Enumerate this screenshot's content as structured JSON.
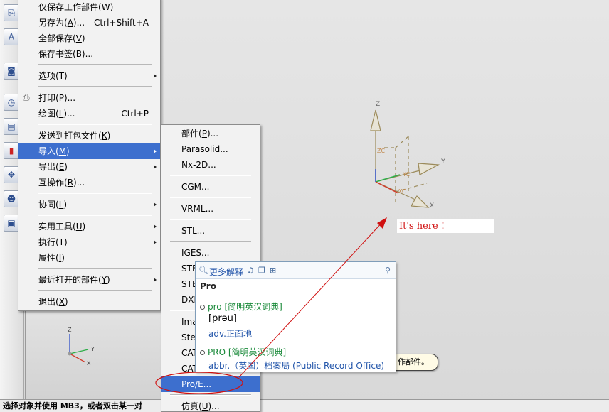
{
  "file_menu": {
    "items": [
      {
        "label": "仅保存工作部件(",
        "key": "W",
        "tail": ")",
        "shortcut": ""
      },
      {
        "label": "另存为(",
        "key": "A",
        "tail": ")...",
        "shortcut": "Ctrl+Shift+A"
      },
      {
        "label": "全部保存(",
        "key": "V",
        "tail": ")",
        "shortcut": ""
      },
      {
        "label": "保存书签(",
        "key": "B",
        "tail": ")...",
        "shortcut": ""
      },
      {
        "label": "选项(",
        "key": "T",
        "tail": ")",
        "shortcut": ""
      },
      {
        "label": "打印(",
        "key": "P",
        "tail": ")...",
        "shortcut": ""
      },
      {
        "label": "绘图(",
        "key": "L",
        "tail": ")...",
        "shortcut": "Ctrl+P"
      },
      {
        "label": "发送到打包文件(",
        "key": "K",
        "tail": ")",
        "shortcut": ""
      },
      {
        "label": "导入(",
        "key": "M",
        "tail": ")",
        "shortcut": ""
      },
      {
        "label": "导出(",
        "key": "E",
        "tail": ")",
        "shortcut": ""
      },
      {
        "label": "互操作(",
        "key": "R",
        "tail": ")...",
        "shortcut": ""
      },
      {
        "label": "协同(",
        "key": "L",
        "tail": ")",
        "shortcut": ""
      },
      {
        "label": "实用工具(",
        "key": "U",
        "tail": ")",
        "shortcut": ""
      },
      {
        "label": "执行(",
        "key": "T",
        "tail": ")",
        "shortcut": ""
      },
      {
        "label": "属性(",
        "key": "I",
        "tail": ")",
        "shortcut": ""
      },
      {
        "label": "最近打开的部件(",
        "key": "Y",
        "tail": ")",
        "shortcut": ""
      },
      {
        "label": "退出(",
        "key": "X",
        "tail": ")",
        "shortcut": ""
      }
    ]
  },
  "import_menu": {
    "items": [
      {
        "label": "部件(",
        "key": "P",
        "tail": ")..."
      },
      {
        "label": "Parasolid..."
      },
      {
        "label": "Nx-2D..."
      },
      {
        "label": "CGM..."
      },
      {
        "label": "VRML..."
      },
      {
        "label": "STL..."
      },
      {
        "label": "IGES..."
      },
      {
        "label": "STE"
      },
      {
        "label": "STE"
      },
      {
        "label": "DXF"
      },
      {
        "label": "Ima"
      },
      {
        "label": "Stei"
      },
      {
        "label": "CAT"
      },
      {
        "label": "CAT"
      },
      {
        "label": "Pro/E..."
      },
      {
        "label": "仿真(",
        "key": "U",
        "tail": ")..."
      }
    ]
  },
  "dictionary": {
    "more_label": "更多解释",
    "word": "Pro",
    "entries": [
      {
        "head": "pro [简明英汉词典]",
        "phonetic": "[prəu]",
        "definition": "adv.正面地"
      },
      {
        "head": "PRO [简明英汉词典]",
        "definition": "abbr.（英国）档案局 (Public Record Office)"
      }
    ]
  },
  "tooltip_text": "作部件。",
  "annotation_text": "It's here !",
  "status_text": "选择对象并使用 MB3，或者双击某一对",
  "triad_labels": {
    "z": "Z",
    "y": "Y",
    "x": "X",
    "zc": "ZC",
    "yc": "YC",
    "xc": "XC"
  },
  "colors": {
    "highlight": "#3d6fce",
    "annotation": "#d01010",
    "dict_link": "#2255aa",
    "dict_head": "#1a8a3a"
  },
  "icons": [
    "save-icon",
    "font-icon",
    "document-icon",
    "clock-icon",
    "layers-icon",
    "color-icon",
    "tool-icon",
    "people-icon",
    "image-icon",
    "printer-icon",
    "search-icon",
    "speaker-icon",
    "copy-icon",
    "plus-icon",
    "pin-icon"
  ]
}
